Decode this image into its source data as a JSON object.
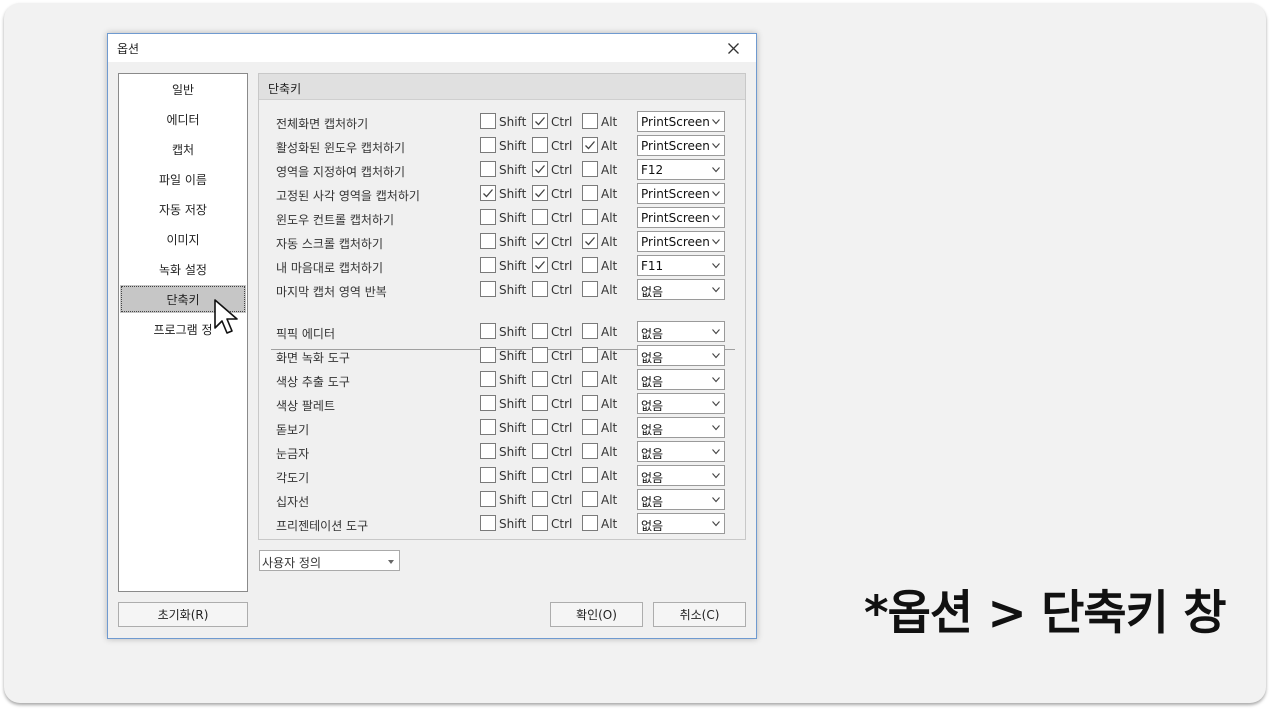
{
  "dialog": {
    "title": "옵션",
    "nav": [
      {
        "label": "일반"
      },
      {
        "label": "에디터"
      },
      {
        "label": "캡처"
      },
      {
        "label": "파일 이름"
      },
      {
        "label": "자동 저장"
      },
      {
        "label": "이미지"
      },
      {
        "label": "녹화 설정"
      },
      {
        "label": "단축키"
      },
      {
        "label": "프로그램 정"
      }
    ],
    "selected_nav": "단축키",
    "section_title": "단축키",
    "modifier_labels": {
      "shift": "Shift",
      "ctrl": "Ctrl",
      "alt": "Alt"
    },
    "rows": [
      {
        "label": "전체화면 캡처하기",
        "shift": false,
        "ctrl": true,
        "alt": false,
        "key": "PrintScreen"
      },
      {
        "label": "활성화된 윈도우 캡처하기",
        "shift": false,
        "ctrl": false,
        "alt": true,
        "key": "PrintScreen"
      },
      {
        "label": "영역을 지정하여 캡처하기",
        "shift": false,
        "ctrl": true,
        "alt": false,
        "key": "F12"
      },
      {
        "label": "고정된 사각 영역을 캡처하기",
        "shift": true,
        "ctrl": true,
        "alt": false,
        "key": "PrintScreen"
      },
      {
        "label": "윈도우 컨트롤 캡처하기",
        "shift": false,
        "ctrl": false,
        "alt": false,
        "key": "PrintScreen"
      },
      {
        "label": "자동 스크롤 캡처하기",
        "shift": false,
        "ctrl": true,
        "alt": true,
        "key": "PrintScreen"
      },
      {
        "label": "내 마음대로 캡처하기",
        "shift": false,
        "ctrl": true,
        "alt": false,
        "key": "F11"
      },
      {
        "label": "마지막 캡처 영역 반복",
        "shift": false,
        "ctrl": false,
        "alt": false,
        "key": "없음"
      },
      {
        "label": "픽픽 에디터",
        "shift": false,
        "ctrl": false,
        "alt": false,
        "key": "없음"
      },
      {
        "label": "화면 녹화 도구",
        "shift": false,
        "ctrl": false,
        "alt": false,
        "key": "없음"
      },
      {
        "label": "색상 추출 도구",
        "shift": false,
        "ctrl": false,
        "alt": false,
        "key": "없음"
      },
      {
        "label": "색상 팔레트",
        "shift": false,
        "ctrl": false,
        "alt": false,
        "key": "없음"
      },
      {
        "label": "돋보기",
        "shift": false,
        "ctrl": false,
        "alt": false,
        "key": "없음"
      },
      {
        "label": "눈금자",
        "shift": false,
        "ctrl": false,
        "alt": false,
        "key": "없음"
      },
      {
        "label": "각도기",
        "shift": false,
        "ctrl": false,
        "alt": false,
        "key": "없음"
      },
      {
        "label": "십자선",
        "shift": false,
        "ctrl": false,
        "alt": false,
        "key": "없음"
      },
      {
        "label": "프리젠테이션 도구",
        "shift": false,
        "ctrl": false,
        "alt": false,
        "key": "없음"
      }
    ],
    "preset": "사용자 정의",
    "buttons": {
      "reset": "초기화(R)",
      "ok": "확인(O)",
      "cancel": "취소(C)"
    }
  },
  "caption": "*옵션 > 단축키 창",
  "colors": {
    "accent_border": "#6f9ad0",
    "selected_nav": "#c6c6c6"
  },
  "icons": {
    "close": "close-icon",
    "dropdown": "chevron-down-icon",
    "cursor": "mouse-pointer-icon",
    "check": "checkmark-icon"
  }
}
